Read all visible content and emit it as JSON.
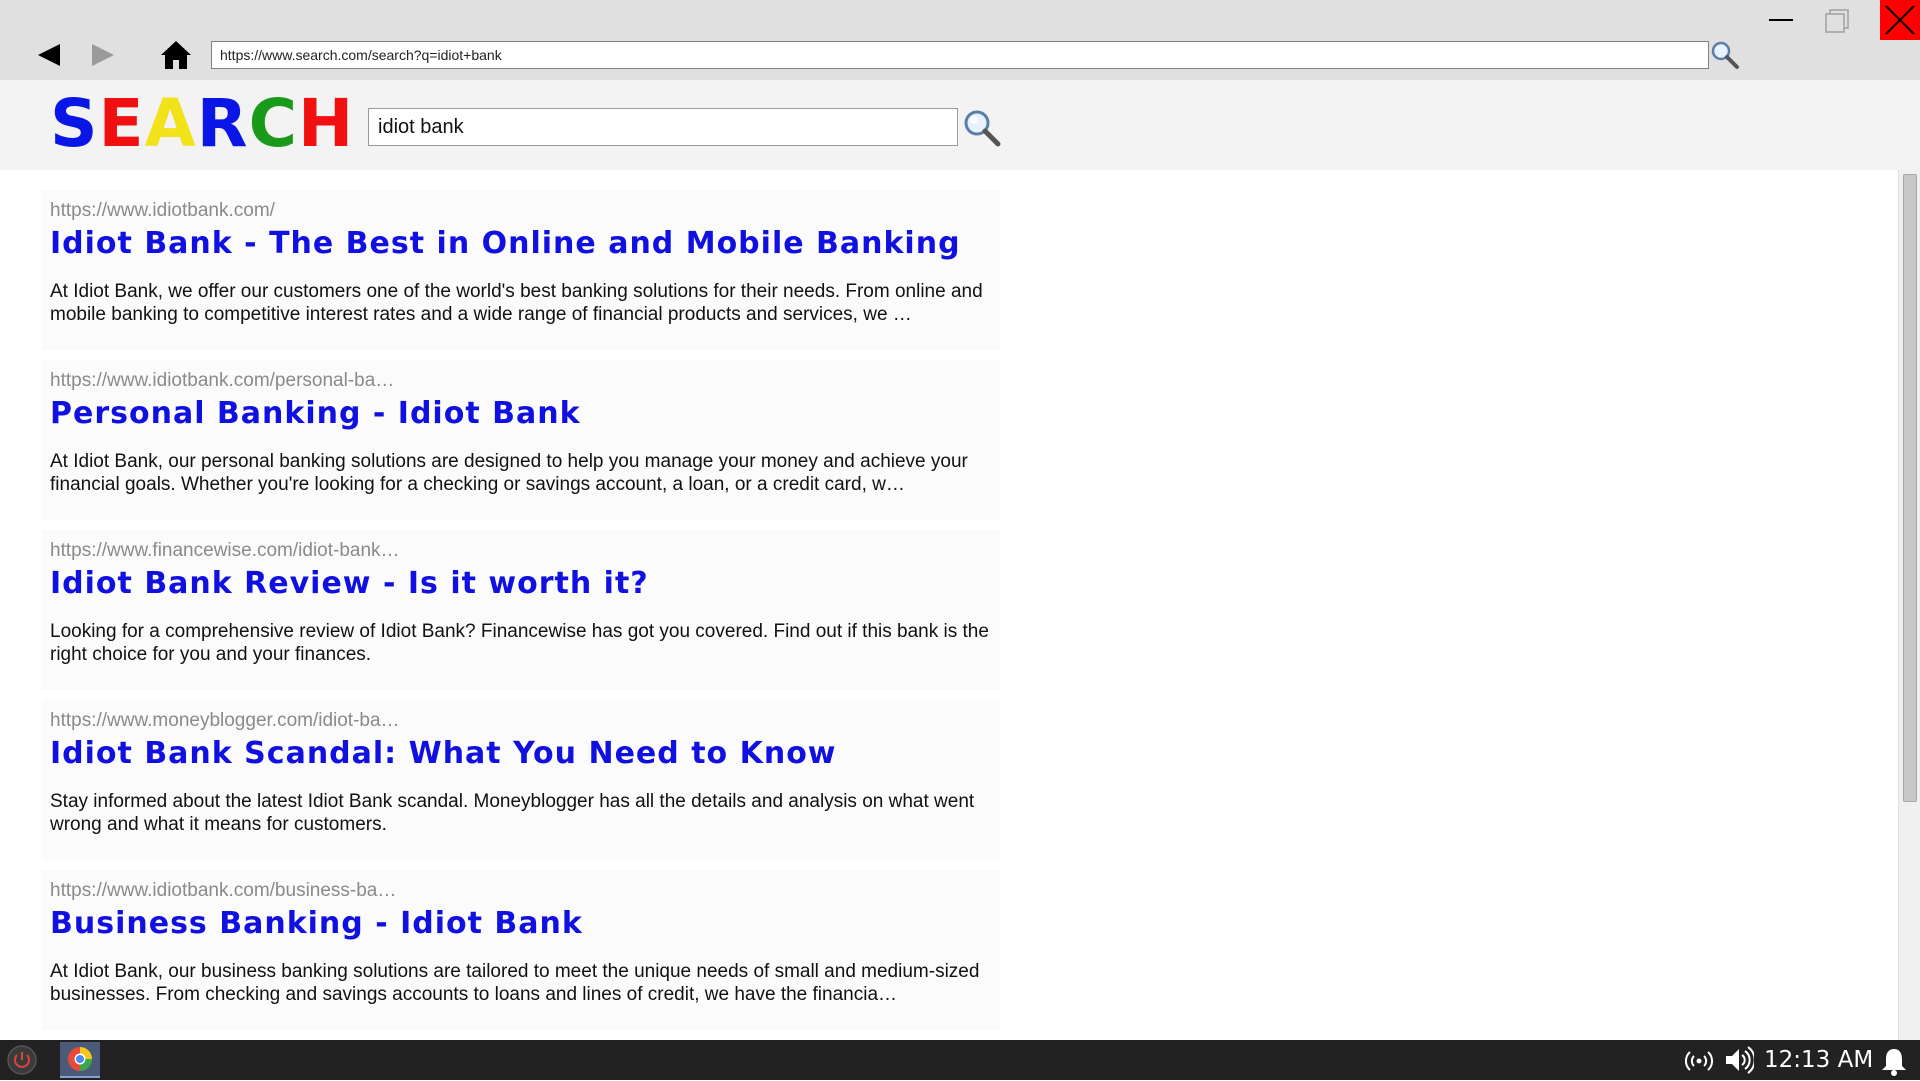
{
  "browser": {
    "url": "https://www.search.com/search?q=idiot+bank",
    "close_color": "#ff0000"
  },
  "search": {
    "logo_letters": [
      {
        "char": "S",
        "color": "#0a16e6"
      },
      {
        "char": "E",
        "color": "#f01010"
      },
      {
        "char": "A",
        "color": "#f2e21a"
      },
      {
        "char": "R",
        "color": "#0a16e6"
      },
      {
        "char": "C",
        "color": "#1a9a1a"
      },
      {
        "char": "H",
        "color": "#f01010"
      }
    ],
    "query": "idiot bank"
  },
  "results": [
    {
      "url": "https://www.idiotbank.com/",
      "title": "Idiot Bank - The Best in Online and Mobile Banking",
      "snippet": "At Idiot Bank, we offer our customers one of the world's best banking solutions for their needs. From online and mobile banking to competitive interest rates and a wide range of financial products and services, we …"
    },
    {
      "url": "https://www.idiotbank.com/personal-ba…",
      "title": "Personal Banking - Idiot Bank",
      "snippet": "At Idiot Bank, our personal banking solutions are designed to help you manage your money and achieve your financial goals. Whether you're looking for a checking or savings account, a loan, or a credit card, w…"
    },
    {
      "url": "https://www.financewise.com/idiot-bank…",
      "title": "Idiot Bank Review - Is it worth it?",
      "snippet": "Looking for a comprehensive review of Idiot Bank? Financewise has got you covered. Find out if this bank is the right choice for you and your finances."
    },
    {
      "url": "https://www.moneyblogger.com/idiot-ba…",
      "title": "Idiot Bank Scandal: What You Need to Know",
      "snippet": "Stay informed about the latest Idiot Bank scandal. Moneyblogger has all the details and analysis on what went wrong and what it means for customers."
    },
    {
      "url": "https://www.idiotbank.com/business-ba…",
      "title": "Business Banking - Idiot Bank",
      "snippet": "At Idiot Bank, our business banking solutions are tailored to meet the unique needs of small and medium-sized businesses. From checking and savings accounts to loans and lines of credit, we have the financia…"
    }
  ],
  "taskbar": {
    "clock": "12:13 AM"
  },
  "icons": {
    "back": "back-arrow-icon",
    "forward": "forward-arrow-icon",
    "home": "home-icon",
    "search": "magnifier-icon",
    "minimize": "minimize-icon",
    "maximize": "maximize-icon",
    "close": "close-icon",
    "power": "power-icon",
    "browser": "browser-app-icon",
    "network": "network-icon",
    "volume": "volume-icon",
    "notifications": "bell-icon"
  }
}
